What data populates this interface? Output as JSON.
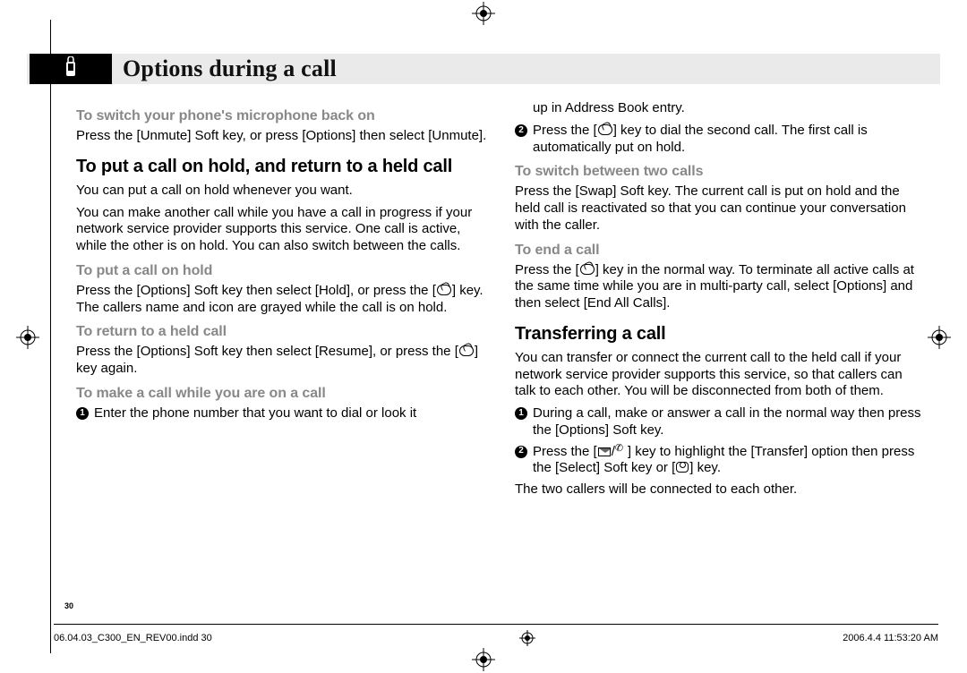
{
  "header": {
    "title": "Options during a call"
  },
  "col1": {
    "h1": "To switch your phone's microphone back on",
    "p1": "Press the [Unmute] Soft key, or press [Options] then select [Unmute].",
    "h2": "To put a call on hold, and return to a held call",
    "p2": "You can put a call on hold whenever you want.",
    "p3": "You can make another call while you have a call in progress if your network service provider supports this service. One call is active, while the other is on hold. You can also switch between the calls.",
    "h3": "To put a call on hold",
    "p4a": "Press the [Options] Soft key then select [Hold], or press the [",
    "p4b": "] key. The callers name and icon are grayed while the call is on hold.",
    "h4": "To return to a held call",
    "p5a": "Press the [Options] Soft key then select [Resume], or press the [",
    "p5b": "] key again.",
    "h5": "To make a call while you are on a call",
    "n1": "Enter the phone number that you want to dial or look it"
  },
  "col2": {
    "p0": "up in Address Book entry.",
    "n2a": "Press the [",
    "n2b": "] key to dial the second call. The first call is automatically put on hold.",
    "h1": "To switch between two calls",
    "p1": "Press the [Swap] Soft key. The current call is put on hold and the held call is reactivated so that you can continue your conversation with the caller.",
    "h2": "To end a call",
    "p2a": "Press the [",
    "p2b": "] key in the normal way. To terminate all active calls at the same time while you are in multi-party call, select [Options] and then select [End All Calls].",
    "h3": "Transferring a call",
    "p3": "You can transfer or connect the current call to the held call if your network service provider supports this service, so that callers can talk to each other. You will be disconnected from both of them.",
    "n1": "During a call, make or answer a call in the normal way then press the [Options] Soft key.",
    "n2c": "Press the [",
    "n2d": "] key to highlight the [Transfer] option then press the [Select] Soft key or [",
    "n2e": "] key.",
    "p4": "The two callers will be connected to each other."
  },
  "page_number": "30",
  "footer": {
    "file": "06.04.03_C300_EN_REV00.indd   30",
    "datetime": "2006.4.4   11:53:20 AM"
  }
}
